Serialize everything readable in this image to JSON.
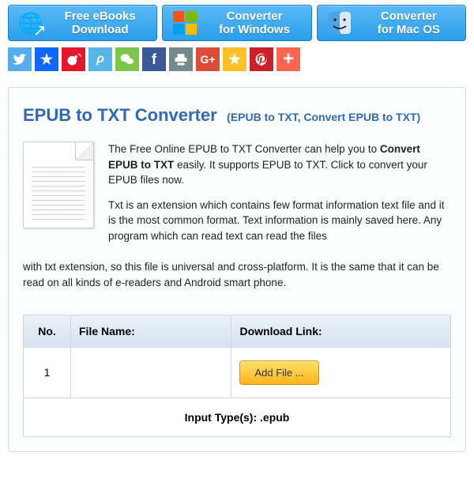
{
  "topButtons": [
    {
      "line1": "Free eBooks",
      "line2": "Download"
    },
    {
      "line1": "Converter",
      "line2": "for Windows"
    },
    {
      "line1": "Converter",
      "line2": "for Mac OS"
    }
  ],
  "title": {
    "main": "EPUB to TXT Converter",
    "sub": "(EPUB to TXT, Convert EPUB to TXT)"
  },
  "intro": {
    "p1_a": "The Free Online EPUB to TXT Converter can help you to ",
    "p1_bold": "Convert EPUB to TXT",
    "p1_b": " easily. It supports EPUB to TXT. Click to convert your EPUB files now.",
    "p2_a": "Txt is an extension which contains few format information text file and it is the most common format. Text information is mainly saved here. Any program which can read text can read the files ",
    "p2_b": "with txt extension, so this file is universal and cross-platform. It is the same that it can be read on all kinds of e-readers and Android smart phone."
  },
  "table": {
    "headers": {
      "no": "No.",
      "file": "File Name:",
      "link": "Download Link:"
    },
    "row1_no": "1",
    "addFile": "Add File ...",
    "inputTypes": "Input Type(s): .epub"
  }
}
